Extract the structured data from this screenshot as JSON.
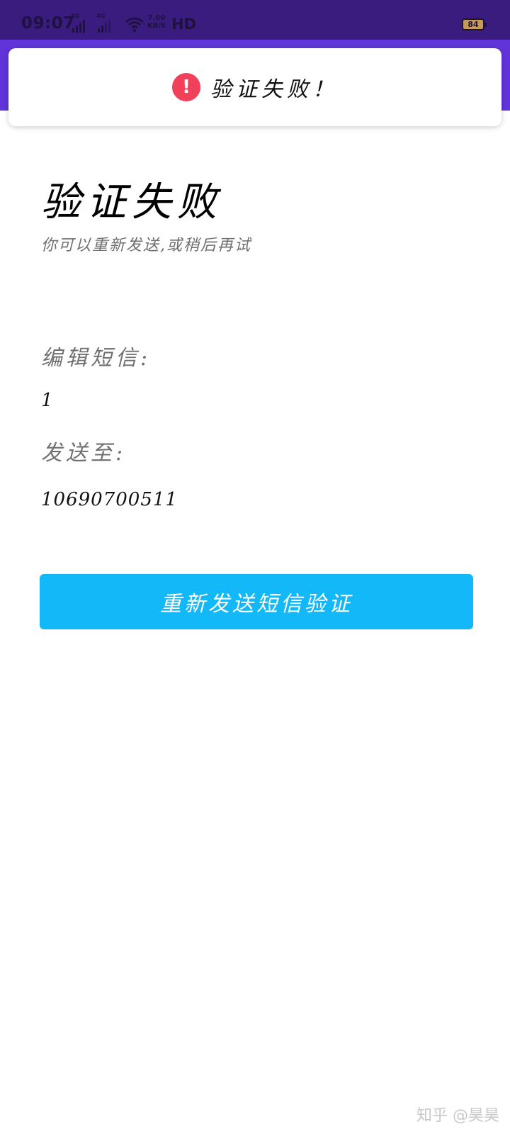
{
  "status_bar": {
    "time": "09:07",
    "sim1_label": "4G",
    "sim2_label": "4G",
    "speed_value": "7.00",
    "speed_unit": "KB/S",
    "hd_label": "HD",
    "battery": "84",
    "icons": [
      "signal-icon",
      "wifi-icon",
      "battery-icon"
    ]
  },
  "toast": {
    "icon": "exclamation-icon",
    "icon_color": "#f0405a",
    "message": "验证失败！"
  },
  "main": {
    "title": "验证失败",
    "subtitle": "你可以重新发送,或稍后再试",
    "edit_sms_label": "编辑短信:",
    "edit_sms_value": "1",
    "send_to_label": "发送至:",
    "send_to_value": "10690700511",
    "resend_button": "重新发送短信验证",
    "button_color": "#12b8f7"
  },
  "watermark": "知乎 @昊昊",
  "colors": {
    "status_bar": "#3a1c7e",
    "app_bar": "#6034d8"
  }
}
